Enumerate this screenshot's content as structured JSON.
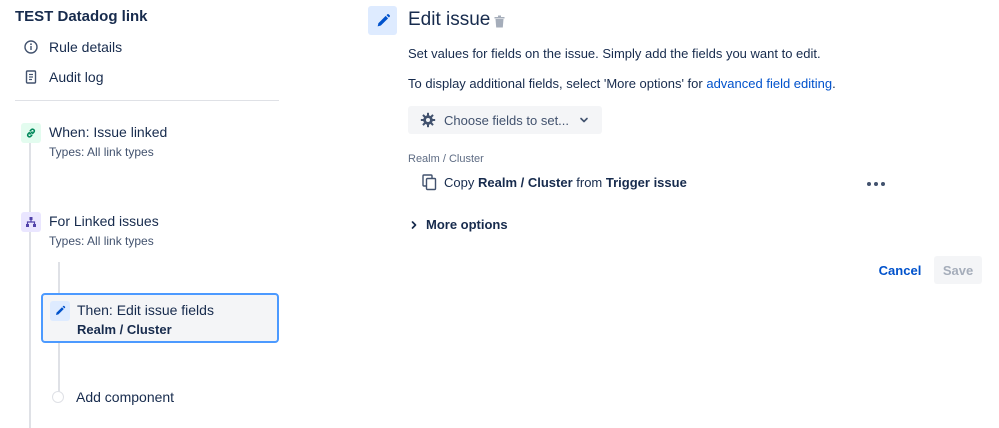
{
  "rule": {
    "title": "TEST Datadog link",
    "nav": {
      "rule_details": "Rule details",
      "audit_log": "Audit log"
    }
  },
  "steps": {
    "trigger": {
      "title": "When: Issue linked",
      "subtitle": "Types: All link types",
      "icon": "link-icon"
    },
    "branch": {
      "title": "For Linked issues",
      "subtitle": "Types: All link types",
      "icon": "branch-icon"
    },
    "action": {
      "title": "Then: Edit issue fields",
      "subtitle": "Realm / Cluster",
      "icon": "pencil-icon"
    },
    "add_component": "Add component"
  },
  "panel": {
    "title": "Edit issue",
    "desc1": "Set values for fields on the issue. Simply add the fields you want to edit.",
    "desc2_prefix": "To display additional fields, select 'More options' for ",
    "desc2_link": "advanced field editing",
    "desc2_suffix": ".",
    "choose_fields": "Choose fields to set...",
    "field": {
      "label": "Realm / Cluster",
      "copy_word": "Copy",
      "field_name": "Realm / Cluster",
      "from_word": "from",
      "source": "Trigger issue"
    },
    "more_options": "More options",
    "cancel": "Cancel",
    "save": "Save"
  },
  "colors": {
    "accent": "#0052CC",
    "selected_border": "#4C9AFF",
    "trigger_badge": "#E3FCEF",
    "branch_badge": "#EAE6FF",
    "action_badge": "#DEEBFF"
  }
}
